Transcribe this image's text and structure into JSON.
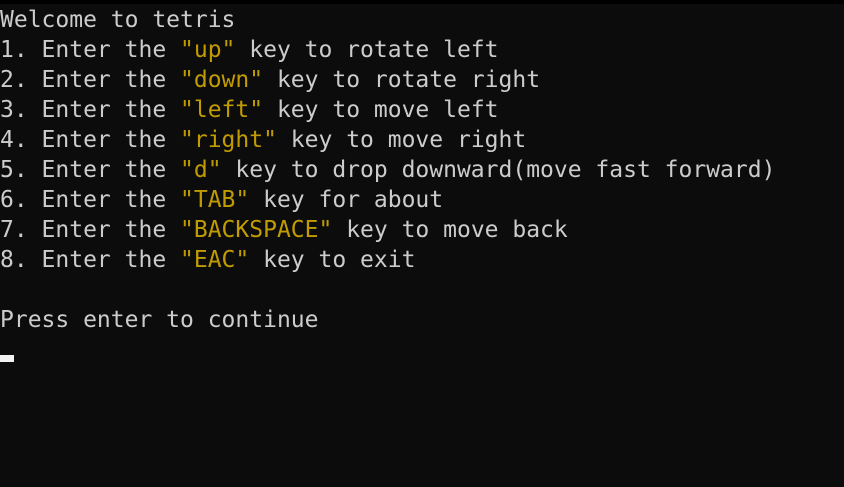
{
  "terminal": {
    "title": "Welcome to tetris",
    "instructions": [
      {
        "prefix": "1. Enter the ",
        "key": "\"up\"",
        "suffix": " key to rotate left"
      },
      {
        "prefix": "2. Enter the ",
        "key": "\"down\"",
        "suffix": " key to rotate right"
      },
      {
        "prefix": "3. Enter the ",
        "key": "\"left\"",
        "suffix": " key to move left"
      },
      {
        "prefix": "4. Enter the ",
        "key": "\"right\"",
        "suffix": " key to move right"
      },
      {
        "prefix": "5. Enter the ",
        "key": "\"d\"",
        "suffix": " key to drop downward(move fast forward)"
      },
      {
        "prefix": "6. Enter the ",
        "key": "\"TAB\"",
        "suffix": " key for about"
      },
      {
        "prefix": "7. Enter the ",
        "key": "\"BACKSPACE\"",
        "suffix": " key to move back"
      },
      {
        "prefix": "8. Enter the ",
        "key": "\"EAC\"",
        "suffix": " key to exit"
      }
    ],
    "prompt": "Press enter to continue",
    "colors": {
      "background": "#0c0c0c",
      "text": "#cccccc",
      "key_highlight": "#c19c00",
      "cursor": "#f2f2f2"
    }
  }
}
